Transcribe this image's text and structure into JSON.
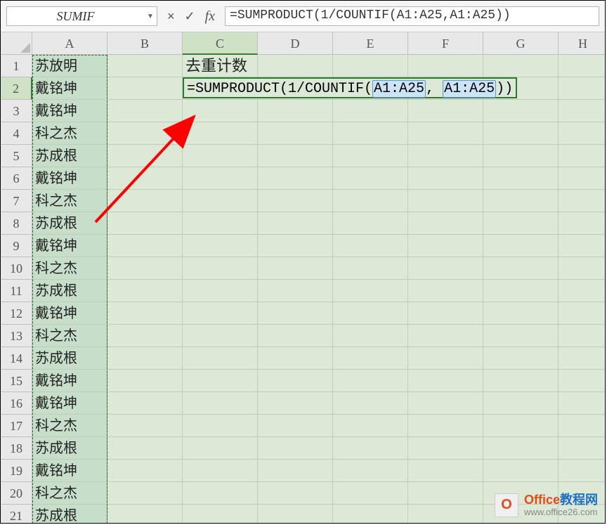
{
  "namebox": {
    "value": "SUMIF"
  },
  "formula_bar": {
    "cancel_icon": "×",
    "confirm_icon": "✓",
    "fx_label": "fx",
    "formula": "=SUMPRODUCT(1/COUNTIF(A1:A25,A1:A25))"
  },
  "columns": [
    "A",
    "B",
    "C",
    "D",
    "E",
    "F",
    "G",
    "H"
  ],
  "active_column": "C",
  "active_row": 2,
  "rows_shown": 21,
  "cells": {
    "C1": "去重计数",
    "C2_formula_parts": {
      "prefix": "=SUMPRODUCT(1/COUNTIF(",
      "ref1": "A1:A25",
      "sep": ", ",
      "ref2": "A1:A25",
      "suffix": "))"
    },
    "A": [
      "苏放明",
      "戴铭坤",
      "戴铭坤",
      "科之杰",
      "苏成根",
      "戴铭坤",
      "科之杰",
      "苏成根",
      "戴铭坤",
      "科之杰",
      "苏成根",
      "戴铭坤",
      "科之杰",
      "苏成根",
      "戴铭坤",
      "戴铭坤",
      "科之杰",
      "苏成根",
      "戴铭坤",
      "科之杰",
      "苏成根"
    ]
  },
  "watermark": {
    "logo_letter": "O",
    "line1_brand": "Office",
    "line1_rest": "教程网",
    "line2": "www.office26.com"
  }
}
